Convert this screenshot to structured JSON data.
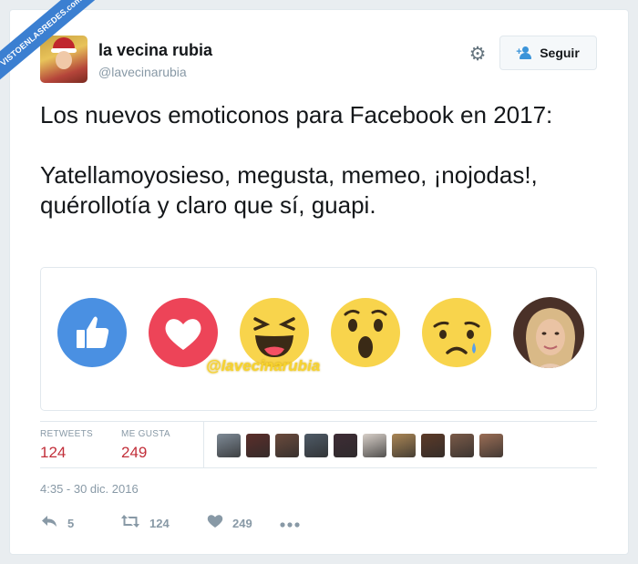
{
  "watermark_badge": "VISTOENLASREDES.com",
  "author": {
    "display_name": "la vecina rubia",
    "handle": "@lavecinarubia"
  },
  "follow_button": {
    "label": "Seguir",
    "icon": "add-user-icon"
  },
  "settings_icon": "gear-icon",
  "tweet": {
    "line1": "Los nuevos emoticonos para Facebook en 2017:",
    "line2": "Yatellamoyosieso, megusta, memeo, ¡nojodas!, quérollotía y claro que sí, guapi."
  },
  "media": {
    "emojis": [
      "like-icon",
      "love-icon",
      "laugh-icon",
      "wow-icon",
      "sad-icon",
      "photo-face"
    ],
    "image_watermark": "@lavecinarubia"
  },
  "stats": {
    "retweets_label": "RETWEETS",
    "retweets_count": "124",
    "likes_label": "ME GUSTA",
    "likes_count": "249",
    "liker_avatar_colors": [
      "#7e8a96",
      "#5b2e2a",
      "#6a4a3c",
      "#4e5a66",
      "#3e2c35",
      "#d7cfc8",
      "#a98555",
      "#5c3a28",
      "#7a5a48",
      "#9a6d55"
    ]
  },
  "timestamp": "4:35 - 30 dic. 2016",
  "actions": {
    "reply_count": "5",
    "retweet_count": "124",
    "like_count": "249"
  },
  "colors": {
    "count_color": "#c22f3a",
    "muted": "#8899a6",
    "text": "#14171a",
    "like_blue": "#4a90e2",
    "love_red": "#ed4458",
    "emoji_yellow": "#f8d44c"
  }
}
